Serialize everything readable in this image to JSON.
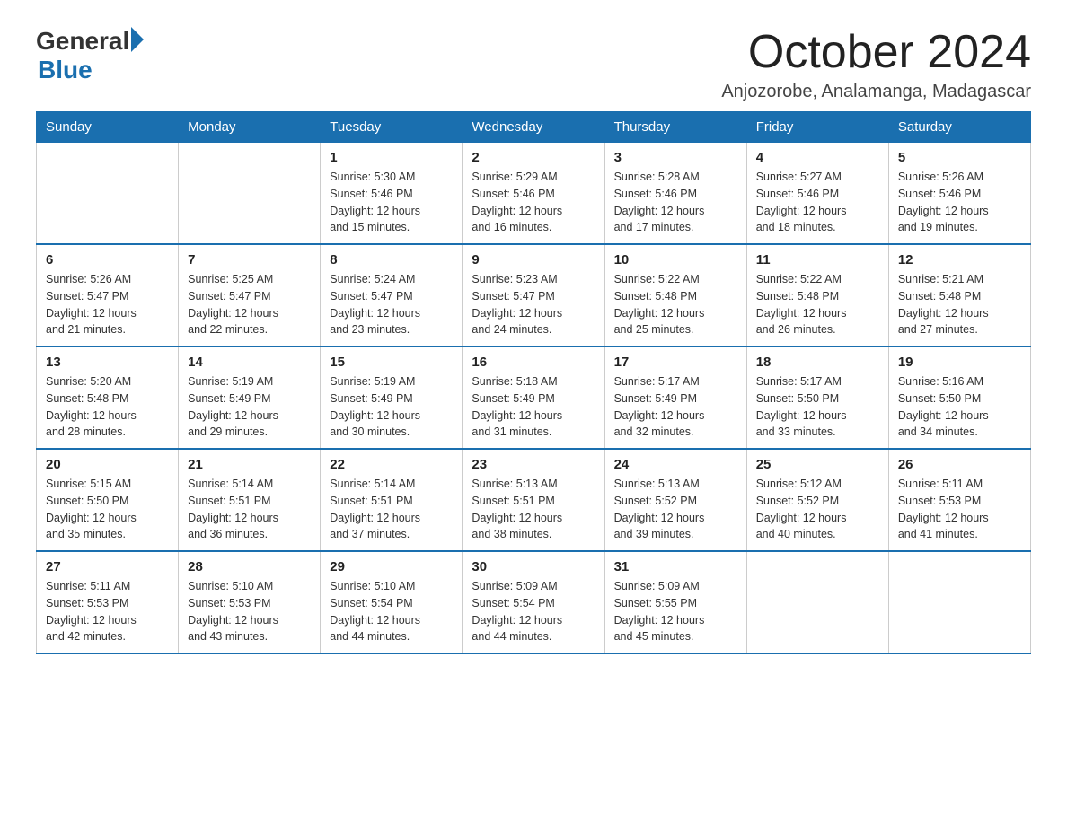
{
  "header": {
    "title": "October 2024",
    "location": "Anjozorobe, Analamanga, Madagascar"
  },
  "logo": {
    "general": "General",
    "blue": "Blue"
  },
  "days_of_week": [
    "Sunday",
    "Monday",
    "Tuesday",
    "Wednesday",
    "Thursday",
    "Friday",
    "Saturday"
  ],
  "weeks": [
    [
      {
        "day": "",
        "info": ""
      },
      {
        "day": "",
        "info": ""
      },
      {
        "day": "1",
        "info": "Sunrise: 5:30 AM\nSunset: 5:46 PM\nDaylight: 12 hours\nand 15 minutes."
      },
      {
        "day": "2",
        "info": "Sunrise: 5:29 AM\nSunset: 5:46 PM\nDaylight: 12 hours\nand 16 minutes."
      },
      {
        "day": "3",
        "info": "Sunrise: 5:28 AM\nSunset: 5:46 PM\nDaylight: 12 hours\nand 17 minutes."
      },
      {
        "day": "4",
        "info": "Sunrise: 5:27 AM\nSunset: 5:46 PM\nDaylight: 12 hours\nand 18 minutes."
      },
      {
        "day": "5",
        "info": "Sunrise: 5:26 AM\nSunset: 5:46 PM\nDaylight: 12 hours\nand 19 minutes."
      }
    ],
    [
      {
        "day": "6",
        "info": "Sunrise: 5:26 AM\nSunset: 5:47 PM\nDaylight: 12 hours\nand 21 minutes."
      },
      {
        "day": "7",
        "info": "Sunrise: 5:25 AM\nSunset: 5:47 PM\nDaylight: 12 hours\nand 22 minutes."
      },
      {
        "day": "8",
        "info": "Sunrise: 5:24 AM\nSunset: 5:47 PM\nDaylight: 12 hours\nand 23 minutes."
      },
      {
        "day": "9",
        "info": "Sunrise: 5:23 AM\nSunset: 5:47 PM\nDaylight: 12 hours\nand 24 minutes."
      },
      {
        "day": "10",
        "info": "Sunrise: 5:22 AM\nSunset: 5:48 PM\nDaylight: 12 hours\nand 25 minutes."
      },
      {
        "day": "11",
        "info": "Sunrise: 5:22 AM\nSunset: 5:48 PM\nDaylight: 12 hours\nand 26 minutes."
      },
      {
        "day": "12",
        "info": "Sunrise: 5:21 AM\nSunset: 5:48 PM\nDaylight: 12 hours\nand 27 minutes."
      }
    ],
    [
      {
        "day": "13",
        "info": "Sunrise: 5:20 AM\nSunset: 5:48 PM\nDaylight: 12 hours\nand 28 minutes."
      },
      {
        "day": "14",
        "info": "Sunrise: 5:19 AM\nSunset: 5:49 PM\nDaylight: 12 hours\nand 29 minutes."
      },
      {
        "day": "15",
        "info": "Sunrise: 5:19 AM\nSunset: 5:49 PM\nDaylight: 12 hours\nand 30 minutes."
      },
      {
        "day": "16",
        "info": "Sunrise: 5:18 AM\nSunset: 5:49 PM\nDaylight: 12 hours\nand 31 minutes."
      },
      {
        "day": "17",
        "info": "Sunrise: 5:17 AM\nSunset: 5:49 PM\nDaylight: 12 hours\nand 32 minutes."
      },
      {
        "day": "18",
        "info": "Sunrise: 5:17 AM\nSunset: 5:50 PM\nDaylight: 12 hours\nand 33 minutes."
      },
      {
        "day": "19",
        "info": "Sunrise: 5:16 AM\nSunset: 5:50 PM\nDaylight: 12 hours\nand 34 minutes."
      }
    ],
    [
      {
        "day": "20",
        "info": "Sunrise: 5:15 AM\nSunset: 5:50 PM\nDaylight: 12 hours\nand 35 minutes."
      },
      {
        "day": "21",
        "info": "Sunrise: 5:14 AM\nSunset: 5:51 PM\nDaylight: 12 hours\nand 36 minutes."
      },
      {
        "day": "22",
        "info": "Sunrise: 5:14 AM\nSunset: 5:51 PM\nDaylight: 12 hours\nand 37 minutes."
      },
      {
        "day": "23",
        "info": "Sunrise: 5:13 AM\nSunset: 5:51 PM\nDaylight: 12 hours\nand 38 minutes."
      },
      {
        "day": "24",
        "info": "Sunrise: 5:13 AM\nSunset: 5:52 PM\nDaylight: 12 hours\nand 39 minutes."
      },
      {
        "day": "25",
        "info": "Sunrise: 5:12 AM\nSunset: 5:52 PM\nDaylight: 12 hours\nand 40 minutes."
      },
      {
        "day": "26",
        "info": "Sunrise: 5:11 AM\nSunset: 5:53 PM\nDaylight: 12 hours\nand 41 minutes."
      }
    ],
    [
      {
        "day": "27",
        "info": "Sunrise: 5:11 AM\nSunset: 5:53 PM\nDaylight: 12 hours\nand 42 minutes."
      },
      {
        "day": "28",
        "info": "Sunrise: 5:10 AM\nSunset: 5:53 PM\nDaylight: 12 hours\nand 43 minutes."
      },
      {
        "day": "29",
        "info": "Sunrise: 5:10 AM\nSunset: 5:54 PM\nDaylight: 12 hours\nand 44 minutes."
      },
      {
        "day": "30",
        "info": "Sunrise: 5:09 AM\nSunset: 5:54 PM\nDaylight: 12 hours\nand 44 minutes."
      },
      {
        "day": "31",
        "info": "Sunrise: 5:09 AM\nSunset: 5:55 PM\nDaylight: 12 hours\nand 45 minutes."
      },
      {
        "day": "",
        "info": ""
      },
      {
        "day": "",
        "info": ""
      }
    ]
  ]
}
